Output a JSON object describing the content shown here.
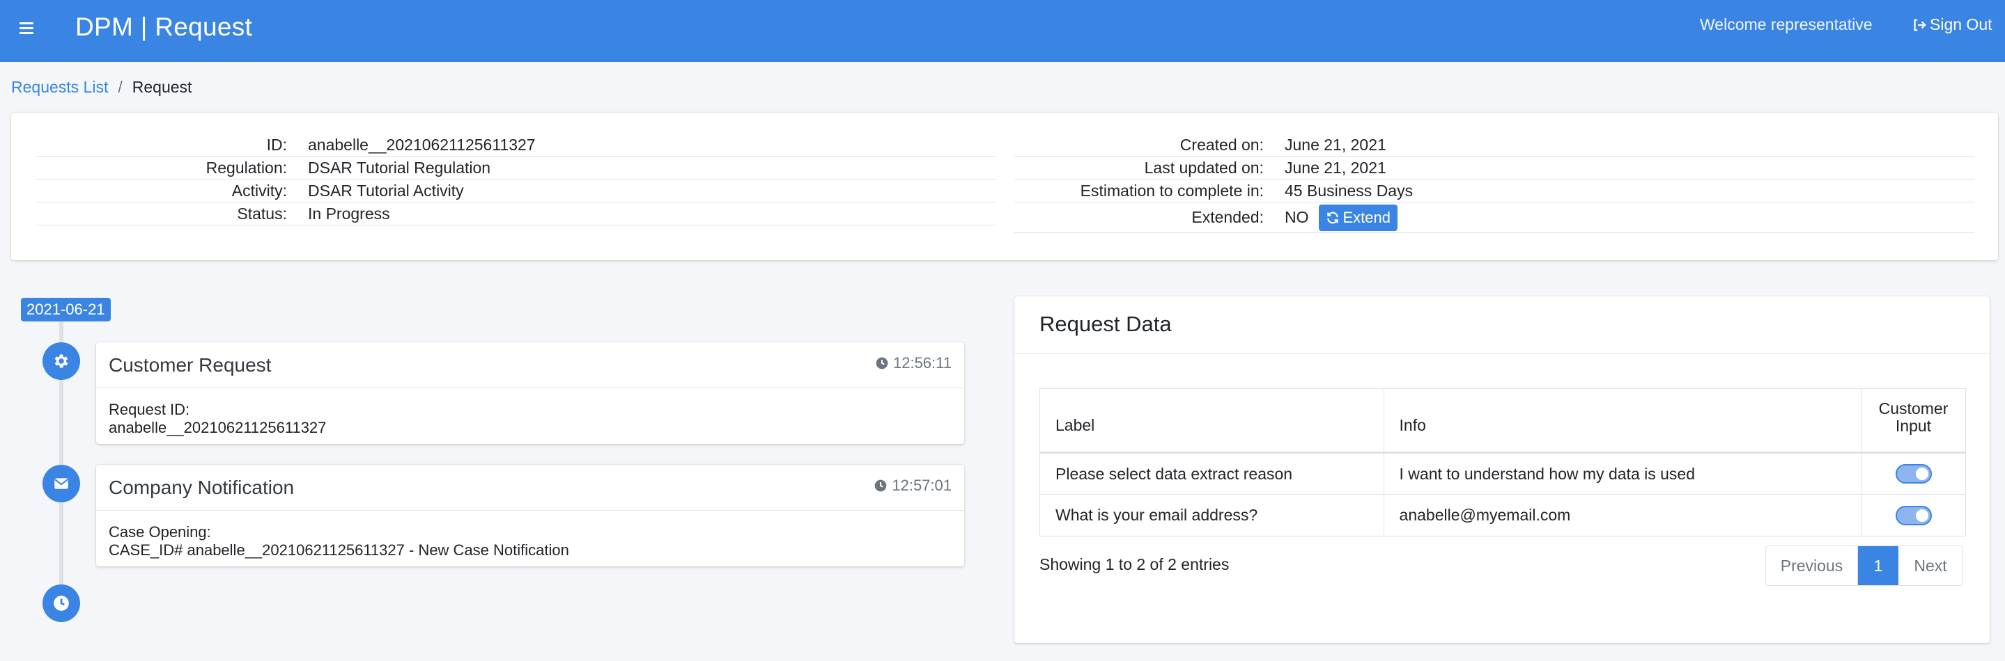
{
  "header": {
    "app_title": "DPM | Request",
    "welcome": "Welcome representative",
    "signout_label": "Sign Out",
    "accent": "#3a85e4"
  },
  "breadcrumb": {
    "parent": "Requests List",
    "separator": "/",
    "current": "Request"
  },
  "request_info": {
    "left": [
      {
        "label": "ID:",
        "value": "anabelle__20210621125611327"
      },
      {
        "label": "Regulation:",
        "value": "DSAR Tutorial Regulation"
      },
      {
        "label": "Activity:",
        "value": "DSAR Tutorial Activity"
      },
      {
        "label": "Status:",
        "value": "In Progress"
      }
    ],
    "right": [
      {
        "label": "Created on:",
        "value": "June 21, 2021"
      },
      {
        "label": "Last updated on:",
        "value": "June 21, 2021"
      },
      {
        "label": "Estimation to complete in:",
        "value": "45 Business Days"
      },
      {
        "label": "Extended:",
        "value": "NO"
      }
    ],
    "extend_label": "Extend"
  },
  "timeline": {
    "date": "2021-06-21",
    "items": [
      {
        "icon": "gear-icon",
        "title": "Customer Request",
        "time": "12:56:11",
        "body_line1": "Request ID:",
        "body_line2": "anabelle__20210621125611327"
      },
      {
        "icon": "envelope-icon",
        "title": "Company Notification",
        "time": "12:57:01",
        "body_line1": "Case Opening:",
        "body_line2": "CASE_ID# anabelle__20210621125611327 - New Case Notification"
      }
    ],
    "end_icon": "clock-icon"
  },
  "request_data": {
    "title": "Request Data",
    "columns": {
      "label": "Label",
      "info": "Info",
      "customer_input": "Customer Input"
    },
    "rows": [
      {
        "label": "Please select data extract reason",
        "info": "I want to understand how my data is used",
        "customer_input": true
      },
      {
        "label": "What is your email address?",
        "info": "anabelle@myemail.com",
        "customer_input": true
      }
    ],
    "showing": "Showing 1 to 2 of 2 entries",
    "pagination": {
      "previous": "Previous",
      "page": "1",
      "next": "Next"
    }
  }
}
